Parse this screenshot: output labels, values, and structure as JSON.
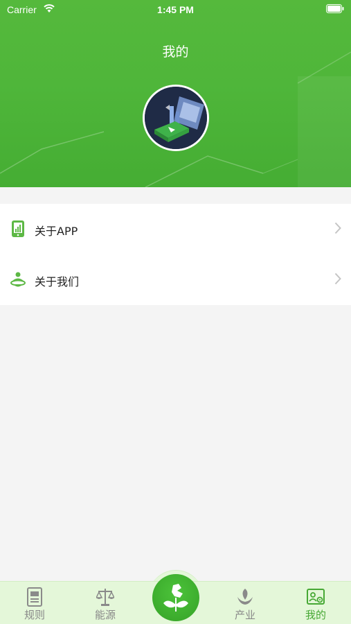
{
  "status_bar": {
    "carrier": "Carrier",
    "time": "1:45 PM",
    "wifi_icon": "wifi-icon",
    "battery_icon": "battery-icon"
  },
  "header": {
    "title": "我的",
    "background_color": "#4fb63a",
    "avatar_icon": "avatar-illustration"
  },
  "menu": {
    "items": [
      {
        "label": "关于APP",
        "icon": "phone-chart-icon"
      },
      {
        "label": "关于我们",
        "icon": "team-globe-icon"
      }
    ],
    "chevron_icon": "chevron-right-icon"
  },
  "tabbar": {
    "tabs": [
      {
        "label": "规则",
        "icon": "document-icon",
        "active": false
      },
      {
        "label": "能源",
        "icon": "scale-icon",
        "active": false
      },
      {
        "label": "",
        "icon": "plant-center-icon",
        "active": false
      },
      {
        "label": "产业",
        "icon": "hand-plant-icon",
        "active": false
      },
      {
        "label": "我的",
        "icon": "profile-card-icon",
        "active": true
      }
    ],
    "active_color": "#46a834",
    "inactive_color": "#888888",
    "background_color": "#e4f7d9"
  }
}
